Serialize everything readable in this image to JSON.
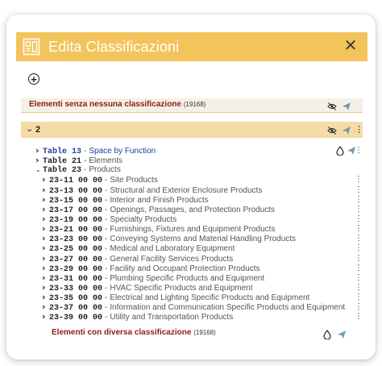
{
  "dialog": {
    "title": "Edita Classificazioni",
    "close_symbol": "✕",
    "header_color": "#f3c45b"
  },
  "toolbar": {
    "add_symbol": "+"
  },
  "unclassified": {
    "label": "Elementi senza nessuna classificazione",
    "count": "(19168)"
  },
  "group": {
    "label": "2"
  },
  "tree": [
    {
      "code": "Table 13",
      "label": "Space by Function",
      "level": 0,
      "expanded": false,
      "highlight": true
    },
    {
      "code": "Table 21",
      "label": "Elements",
      "level": 0,
      "expanded": false,
      "highlight": false
    },
    {
      "code": "Table 23",
      "label": "Products",
      "level": 0,
      "expanded": true,
      "highlight": false
    },
    {
      "code": "23-11 00 00",
      "label": "Site Products",
      "level": 1
    },
    {
      "code": "23-13 00 00",
      "label": "Structural and Exterior Enclosure Products",
      "level": 1
    },
    {
      "code": "23-15 00 00",
      "label": "Interior and Finish Products",
      "level": 1
    },
    {
      "code": "23-17 00 00",
      "label": "Openings, Passages, and Protection Products",
      "level": 1
    },
    {
      "code": "23-19 00 00",
      "label": "Specialty Products",
      "level": 1
    },
    {
      "code": "23-21 00 00",
      "label": "Furnishings, Fixtures and Equipment Products",
      "level": 1
    },
    {
      "code": "23-23 00 00",
      "label": "Conveying Systems and Material Handling Products",
      "level": 1
    },
    {
      "code": "23-25 00 00",
      "label": "Medical and Laboratory Equipment",
      "level": 1
    },
    {
      "code": "23-27 00 00",
      "label": "General Facility Services Products",
      "level": 1
    },
    {
      "code": "23-29 00 00",
      "label": "Facility and Occupant Protection Products",
      "level": 1
    },
    {
      "code": "23-31 00 00",
      "label": "Plumbing Specific Products and Equipment",
      "level": 1
    },
    {
      "code": "23-33 00 00",
      "label": "HVAC Specific Products and Equipment",
      "level": 1
    },
    {
      "code": "23-35 00 00",
      "label": "Electrical and Lighting Specific Products and Equipment",
      "level": 1
    },
    {
      "code": "23-37 00 00",
      "label": "Information and Communication Specific Products and Equipment",
      "level": 1
    },
    {
      "code": "23-39 00 00",
      "label": "Utility and Transportation Products",
      "level": 1
    }
  ],
  "different": {
    "label": "Elementi con diversa classificazione",
    "count": "(19168)"
  },
  "icons": {
    "header": "document-grid-icon",
    "visibility_off": "eye-off-icon",
    "send": "send-icon",
    "more": "kebab-menu-icon",
    "drop": "droplet-icon",
    "add": "add-circle-icon"
  },
  "colors": {
    "accent_red": "#8a1e18",
    "link_blue": "#1a3f9a",
    "send_teal": "#6f9bb4"
  }
}
